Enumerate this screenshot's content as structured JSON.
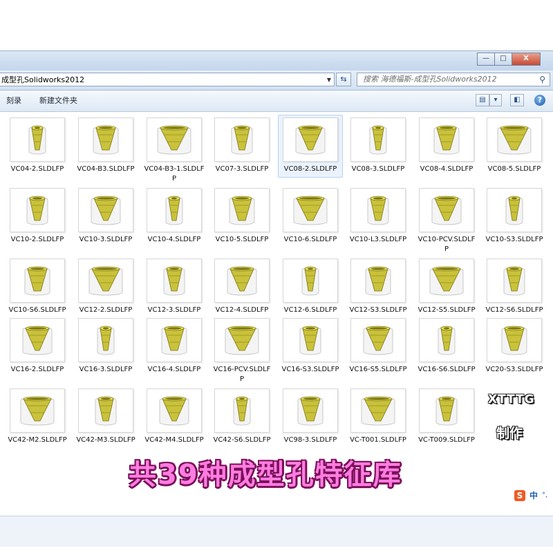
{
  "address": {
    "path": "成型孔Solidworks2012"
  },
  "search": {
    "placeholder": "搜索 海德福斯-成型孔Solidworks2012"
  },
  "toolbar": {
    "burn_label": "刻录",
    "new_folder_label": "新建文件夹"
  },
  "window_controls": {
    "minimize": "—",
    "maximize": "□",
    "close": "X"
  },
  "files": [
    "VC04-2.SLDLFP",
    "VC04-B3.SLDLFP",
    "VC04-B3-1.SLDLFP",
    "VC07-3.SLDLFP",
    "VC08-2.SLDLFP",
    "VC08-3.SLDLFP",
    "VC08-4.SLDLFP",
    "VC08-5.SLDLFP",
    "VC10-2.SLDLFP",
    "VC10-3.SLDLFP",
    "VC10-4.SLDLFP",
    "VC10-5.SLDLFP",
    "VC10-6.SLDLFP",
    "VC10-L3.SLDLFP",
    "VC10-PCV.SLDLFP",
    "VC10-S3.SLDLFP",
    "VC10-S6.SLDLFP",
    "VC12-2.SLDLFP",
    "VC12-3.SLDLFP",
    "VC12-4.SLDLFP",
    "VC12-6.SLDLFP",
    "VC12-S3.SLDLFP",
    "VC12-S5.SLDLFP",
    "VC12-S6.SLDLFP",
    "VC16-2.SLDLFP",
    "VC16-3.SLDLFP",
    "VC16-4.SLDLFP",
    "VC16-PCV.SLDLFP",
    "VC16-S3.SLDLFP",
    "VC16-S5.SLDLFP",
    "VC16-S6.SLDLFP",
    "VC20-S3.SLDLFP",
    "VC42-M2.SLDLFP",
    "VC42-M3.SLDLFP",
    "VC42-M4.SLDLFP",
    "VC42-S6.SLDLFP",
    "VC98-3.SLDLFP",
    "VC-T001.SLDLFP",
    "VC-T009.SLDLFP"
  ],
  "selected_index": 4,
  "watermark": {
    "line1": "XTTTG",
    "line2": "制作",
    "banner": "共39种成型孔特征库"
  },
  "ime": {
    "logo": "S",
    "mode": "中",
    "punct": "°,"
  },
  "colors": {
    "model_yellow": "#c9c23a",
    "model_dark": "#7a7414",
    "banner_pink": "#ff7de0"
  }
}
